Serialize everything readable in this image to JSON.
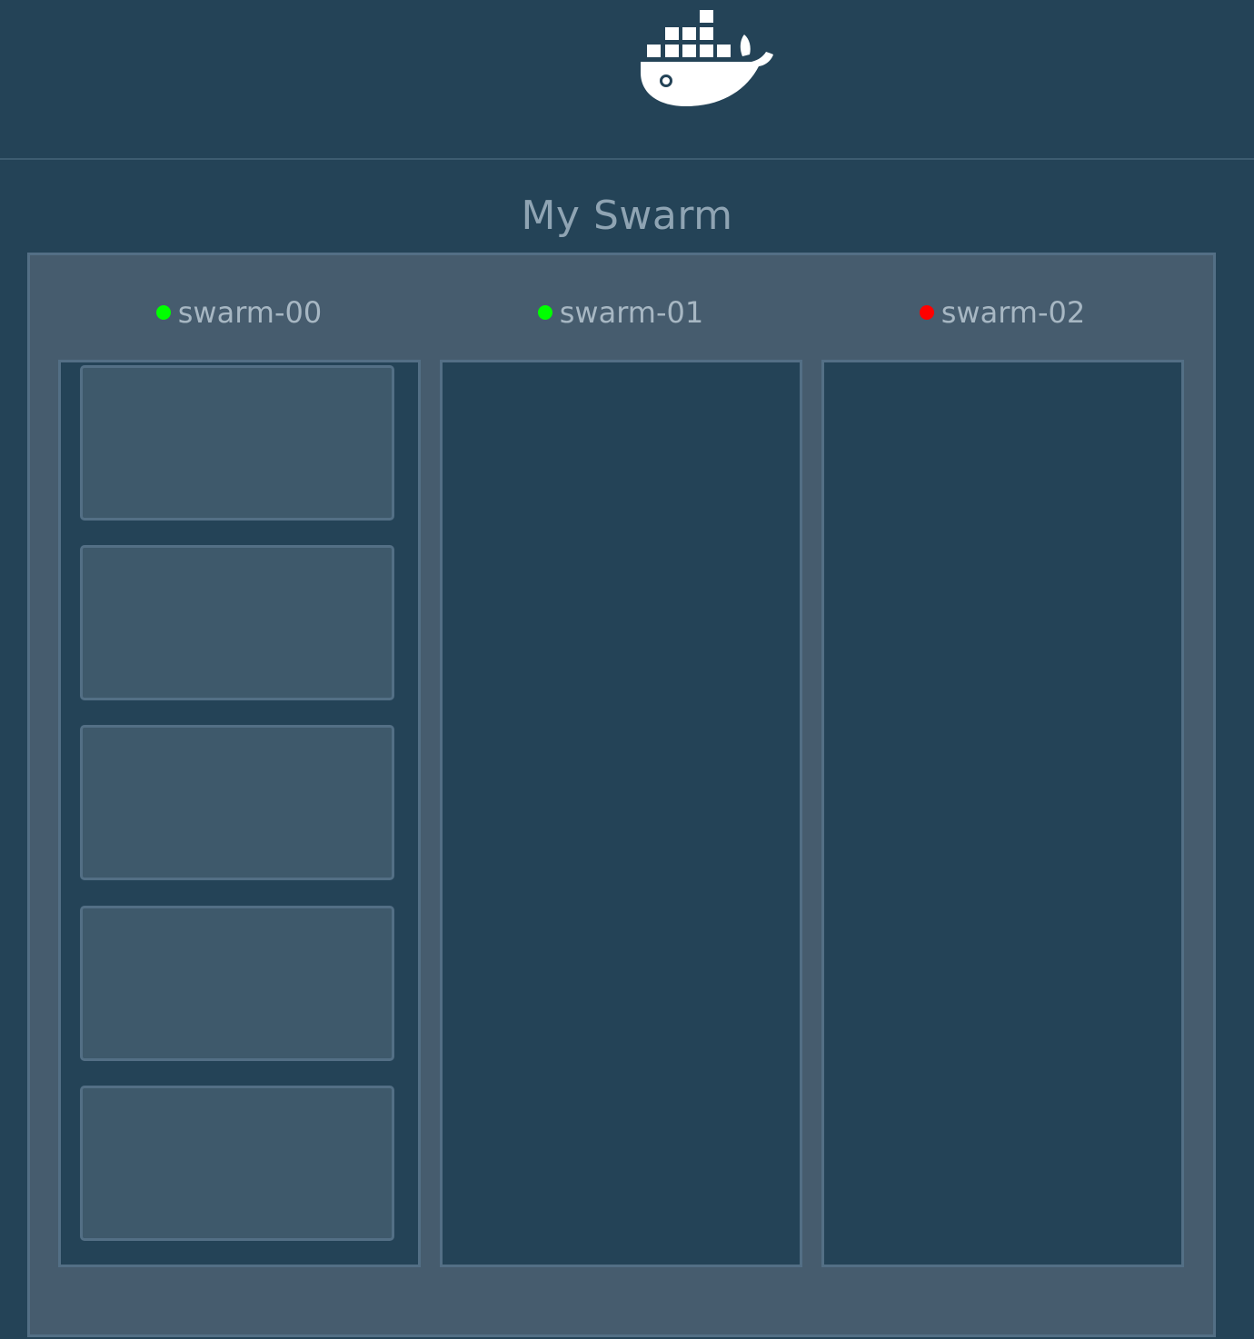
{
  "app": {
    "logo": "docker-whale-logo",
    "title": "My Swarm"
  },
  "colors": {
    "background": "#244357",
    "panel": "#465c6e",
    "border": "#536f85",
    "card": "#3e596b",
    "status_up": "#00ff00",
    "status_down": "#ff0000"
  },
  "nodes": [
    {
      "name": "swarm-00",
      "status": "up",
      "container_count": 5
    },
    {
      "name": "swarm-01",
      "status": "up",
      "container_count": 0
    },
    {
      "name": "swarm-02",
      "status": "down",
      "container_count": 0
    }
  ]
}
